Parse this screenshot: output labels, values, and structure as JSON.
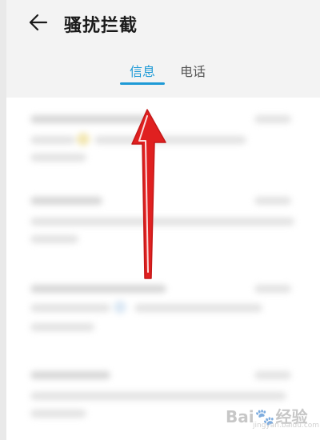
{
  "header": {
    "title": "骚扰拦截",
    "back_icon": "arrow-left-icon"
  },
  "tabs": [
    {
      "label": "信息",
      "active": true
    },
    {
      "label": "电话",
      "active": false
    }
  ],
  "colors": {
    "accent": "#1e9ad6",
    "annotation_arrow": "#e02020"
  },
  "annotation": {
    "icon": "red-up-arrow-icon"
  },
  "watermark": {
    "brand": "Bai",
    "brand2": "经验",
    "url": "jingyan.baidu.com"
  }
}
